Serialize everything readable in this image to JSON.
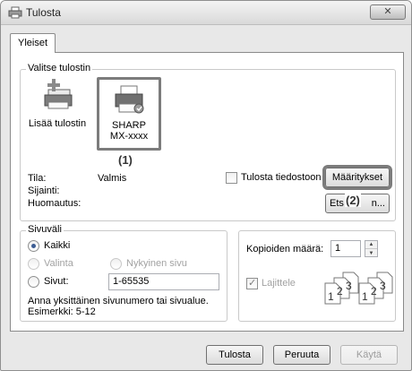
{
  "window": {
    "title": "Tulosta",
    "title_icon": "printer-icon",
    "close_icon": "close-icon"
  },
  "tabs": [
    {
      "label": "Yleiset"
    }
  ],
  "select_printer": {
    "group_label": "Valitse tulostin",
    "items": [
      {
        "label": "Lisää tulostin",
        "icon": "add-printer-icon"
      },
      {
        "label_line1": "SHARP",
        "label_line2": "MX-xxxx",
        "icon": "printer-icon",
        "selected": true
      }
    ],
    "callout_1": "(1)"
  },
  "status": {
    "state_label": "Tila:",
    "state_value": "Valmis",
    "location_label": "Sijainti:",
    "comment_label": "Huomautus:",
    "print_to_file_label": "Tulosta tiedostoon",
    "print_to_file_checked": false,
    "preferences_label": "Määritykset",
    "find_printer_label_start": "Ets",
    "find_printer_label_end": "n...",
    "callout_2": "(2)"
  },
  "page_range": {
    "group_label": "Sivuväli",
    "all_label": "Kaikki",
    "selection_label": "Valinta",
    "current_page_label": "Nykyinen sivu",
    "pages_label": "Sivut:",
    "pages_value": "1-65535",
    "hint_line1": "Anna yksittäinen sivunumero tai sivualue.",
    "hint_line2": "Esimerkki: 5-12",
    "selected": "all"
  },
  "copies": {
    "count_label": "Kopioiden määrä:",
    "count_value": "1",
    "collate_label": "Lajittele",
    "collate_checked": true,
    "collate_digits": [
      "1",
      "2",
      "3"
    ]
  },
  "footer": {
    "print_label": "Tulosta",
    "cancel_label": "Peruuta",
    "apply_label": "Käytä"
  }
}
